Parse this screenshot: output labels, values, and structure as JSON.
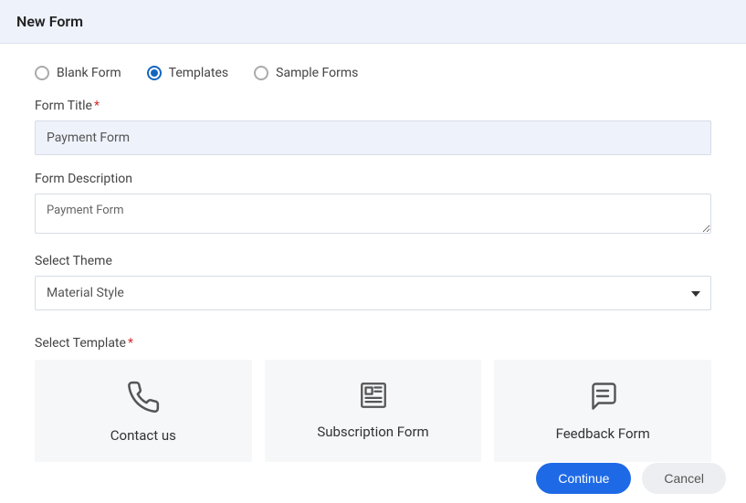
{
  "header": {
    "title": "New Form"
  },
  "options": {
    "blank": "Blank Form",
    "templates": "Templates",
    "sample": "Sample Forms",
    "selected": "templates"
  },
  "fields": {
    "title_label": "Form Title",
    "title_value": "Payment Form",
    "desc_label": "Form Description",
    "desc_value": "Payment Form",
    "theme_label": "Select Theme",
    "theme_value": "Material Style",
    "template_label": "Select Template"
  },
  "templates": {
    "contact": "Contact us",
    "subscription": "Subscription Form",
    "feedback": "Feedback Form"
  },
  "buttons": {
    "continue": "Continue",
    "cancel": "Cancel"
  }
}
